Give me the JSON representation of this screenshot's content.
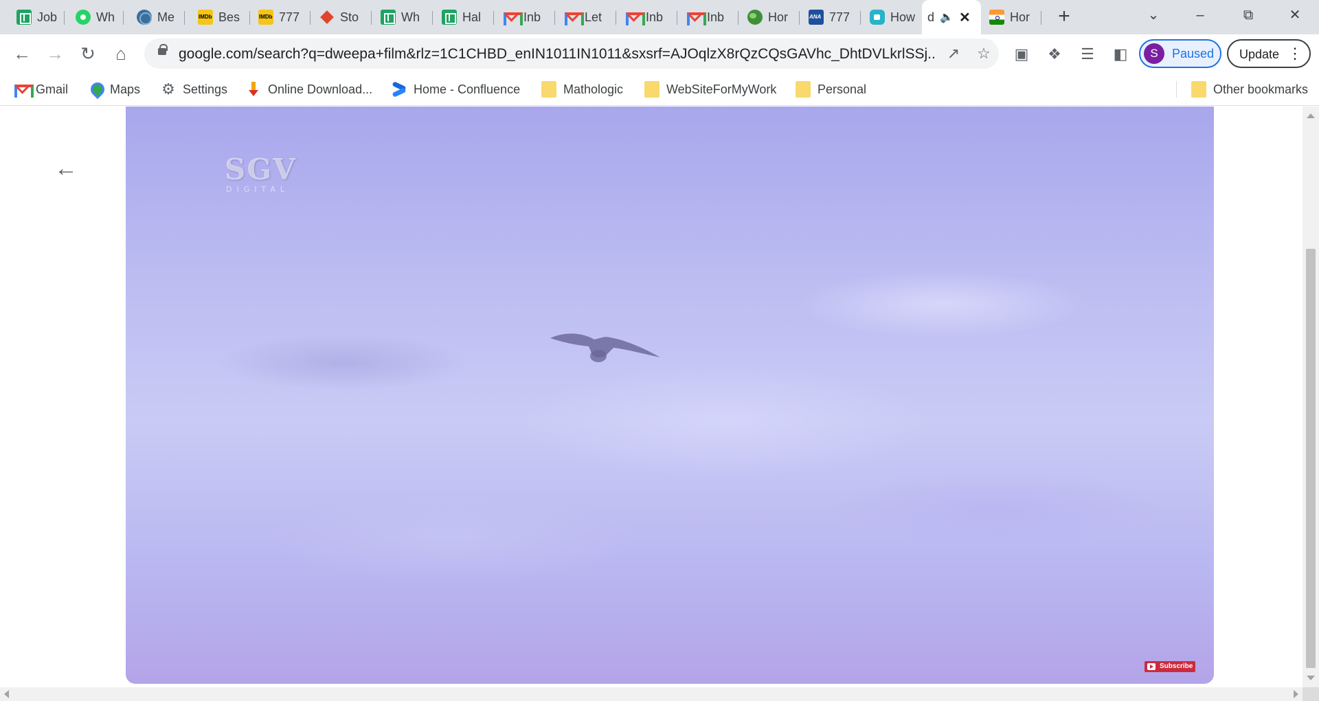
{
  "tabs": [
    {
      "label": "Job",
      "icon": "google-sheets-icon"
    },
    {
      "label": "Wh",
      "icon": "whatsapp-icon"
    },
    {
      "label": "Me",
      "icon": "globe-icon"
    },
    {
      "label": "Bes",
      "icon": "imdb-icon"
    },
    {
      "label": "777",
      "icon": "imdb-icon"
    },
    {
      "label": "Sto",
      "icon": "diamond-icon"
    },
    {
      "label": "Wh",
      "icon": "google-sheets-icon"
    },
    {
      "label": "Hal",
      "icon": "google-sheets-icon"
    },
    {
      "label": "Inb",
      "icon": "gmail-icon"
    },
    {
      "label": "Let",
      "icon": "gmail-icon"
    },
    {
      "label": "Inb",
      "icon": "gmail-icon"
    },
    {
      "label": "Inb",
      "icon": "gmail-icon"
    },
    {
      "label": "Hor",
      "icon": "earth-icon"
    },
    {
      "label": "777",
      "icon": "ana-icon"
    },
    {
      "label": "How",
      "icon": "google-meet-icon"
    },
    {
      "label": "d",
      "icon": "audio-playing-icon",
      "active": true
    },
    {
      "label": "Hor",
      "icon": "india-flag-icon"
    }
  ],
  "toolbar": {
    "url": "google.com/search?q=dweepa+film&rlz=1C1CHBD_enIN1011IN1011&sxsrf=AJOqlzX8rQzCQsGAVhc_DhtDVLkrlSSj...",
    "profile_initial": "S",
    "profile_status": "Paused",
    "update_label": "Update"
  },
  "bookmarks": {
    "items": [
      {
        "label": "Gmail",
        "icon": "gmail-icon"
      },
      {
        "label": "Maps",
        "icon": "maps-icon"
      },
      {
        "label": "Settings",
        "icon": "gear-icon"
      },
      {
        "label": "Online Download...",
        "icon": "download-icon"
      },
      {
        "label": "Home - Confluence",
        "icon": "confluence-icon"
      },
      {
        "label": "Mathologic",
        "icon": "folder-icon"
      },
      {
        "label": "WebSiteForMyWork",
        "icon": "folder-icon"
      },
      {
        "label": "Personal",
        "icon": "folder-icon"
      }
    ],
    "other": "Other bookmarks"
  },
  "video": {
    "watermark": "SGV",
    "watermark_sub": "DIGITAL",
    "subscribe_label": "Subscribe"
  },
  "colors": {
    "accent": "#1a73e8",
    "subscribe": "#cc2b3d",
    "sky": "#b9b9f0"
  }
}
